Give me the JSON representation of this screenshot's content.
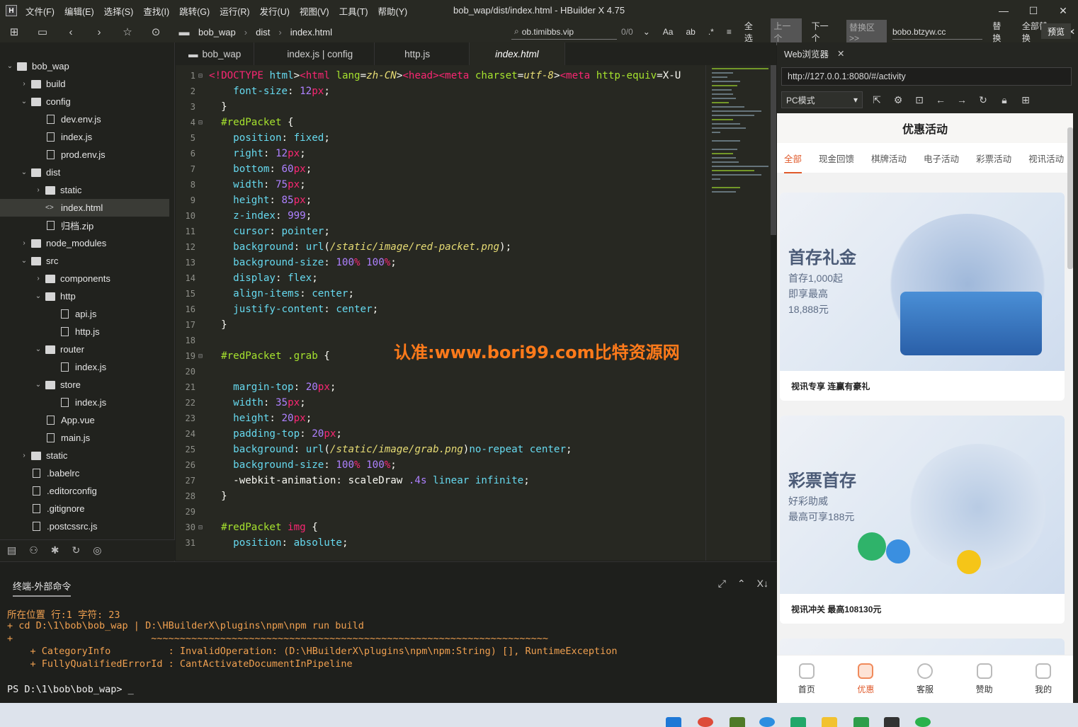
{
  "titlebar": {
    "menus": [
      "文件(F)",
      "编辑(E)",
      "选择(S)",
      "查找(I)",
      "跳转(G)",
      "运行(R)",
      "发行(U)",
      "视图(V)",
      "工具(T)",
      "帮助(Y)"
    ],
    "title": "bob_wap/dist/index.html - HBuilder X 4.75",
    "app_icon": "H"
  },
  "toolbar": {
    "breadcrumb": [
      "bob_wap",
      "dist",
      "index.html"
    ],
    "find": {
      "value": "ob.timibbs.vip",
      "count": "0/0",
      "aa": "Aa",
      "ab": "ab",
      "select_all": "全选",
      "prev": "上一个",
      "next": "下一个",
      "replace_area": "替换区>>",
      "replace_value": "bobo.btzyw.cc",
      "replace": "替换",
      "replace_all": "全部替换"
    },
    "preview": "预览"
  },
  "tree": [
    {
      "label": "bob_wap",
      "indent": 0,
      "arrow": "down",
      "type": "folder"
    },
    {
      "label": "build",
      "indent": 1,
      "arrow": "right",
      "type": "folder"
    },
    {
      "label": "config",
      "indent": 1,
      "arrow": "down",
      "type": "folder"
    },
    {
      "label": "dev.env.js",
      "indent": 2,
      "arrow": "",
      "type": "file"
    },
    {
      "label": "index.js",
      "indent": 2,
      "arrow": "",
      "type": "file"
    },
    {
      "label": "prod.env.js",
      "indent": 2,
      "arrow": "",
      "type": "file"
    },
    {
      "label": "dist",
      "indent": 1,
      "arrow": "down",
      "type": "folder"
    },
    {
      "label": "static",
      "indent": 2,
      "arrow": "right",
      "type": "folder"
    },
    {
      "label": "index.html",
      "indent": 2,
      "arrow": "",
      "type": "code",
      "selected": true
    },
    {
      "label": "归档.zip",
      "indent": 2,
      "arrow": "",
      "type": "file"
    },
    {
      "label": "node_modules",
      "indent": 1,
      "arrow": "right",
      "type": "folder"
    },
    {
      "label": "src",
      "indent": 1,
      "arrow": "down",
      "type": "folder"
    },
    {
      "label": "components",
      "indent": 2,
      "arrow": "right",
      "type": "folder"
    },
    {
      "label": "http",
      "indent": 2,
      "arrow": "down",
      "type": "folder"
    },
    {
      "label": "api.js",
      "indent": 3,
      "arrow": "",
      "type": "file"
    },
    {
      "label": "http.js",
      "indent": 3,
      "arrow": "",
      "type": "file"
    },
    {
      "label": "router",
      "indent": 2,
      "arrow": "down",
      "type": "folder"
    },
    {
      "label": "index.js",
      "indent": 3,
      "arrow": "",
      "type": "file"
    },
    {
      "label": "store",
      "indent": 2,
      "arrow": "down",
      "type": "folder"
    },
    {
      "label": "index.js",
      "indent": 3,
      "arrow": "",
      "type": "file"
    },
    {
      "label": "App.vue",
      "indent": 2,
      "arrow": "",
      "type": "file"
    },
    {
      "label": "main.js",
      "indent": 2,
      "arrow": "",
      "type": "file"
    },
    {
      "label": "static",
      "indent": 1,
      "arrow": "right",
      "type": "folder"
    },
    {
      "label": ".babelrc",
      "indent": 1,
      "arrow": "",
      "type": "file"
    },
    {
      "label": ".editorconfig",
      "indent": 1,
      "arrow": "",
      "type": "file"
    },
    {
      "label": ".gitignore",
      "indent": 1,
      "arrow": "",
      "type": "file"
    },
    {
      "label": ".postcssrc.js",
      "indent": 1,
      "arrow": "",
      "type": "file"
    }
  ],
  "tabs": [
    {
      "label": "bob_wap",
      "active": false
    },
    {
      "label": "index.js | config",
      "active": false
    },
    {
      "label": "http.js",
      "active": false
    },
    {
      "label": "index.html",
      "active": true
    }
  ],
  "code": [
    {
      "n": "1",
      "f": "⊟",
      "t": [
        [
          "kw",
          "<!"
        ],
        [
          "kw",
          "DOCTYPE"
        ],
        [
          "pl",
          " "
        ],
        [
          "prop",
          "html"
        ],
        [
          "pl",
          ">"
        ],
        [
          "kw",
          "<html "
        ],
        [
          "sel2",
          "lang"
        ],
        [
          "pl",
          "="
        ],
        [
          "str",
          "zh-CN"
        ],
        [
          "pl",
          ">"
        ],
        [
          "kw",
          "<head>"
        ],
        [
          "kw",
          "<meta "
        ],
        [
          "sel2",
          "charset"
        ],
        [
          "pl",
          "="
        ],
        [
          "str",
          "utf-8"
        ],
        [
          "pl",
          ">"
        ],
        [
          "kw",
          "<meta "
        ],
        [
          "sel2",
          "http-equiv"
        ],
        [
          "pl",
          "=X-U"
        ]
      ]
    },
    {
      "n": "2",
      "f": "",
      "t": [
        [
          "prop",
          "    font-size"
        ],
        [
          "pl",
          ": "
        ],
        [
          "num",
          "12"
        ],
        [
          "unit",
          "px"
        ],
        [
          "pl",
          ";"
        ]
      ]
    },
    {
      "n": "3",
      "f": "",
      "t": [
        [
          "pl",
          "  }"
        ]
      ]
    },
    {
      "n": "4",
      "f": "⊟",
      "t": [
        [
          "sel2",
          "  #redPacket"
        ],
        [
          "pl",
          " {"
        ]
      ]
    },
    {
      "n": "5",
      "f": "",
      "t": [
        [
          "prop",
          "    position"
        ],
        [
          "pl",
          ": "
        ],
        [
          "val",
          "fixed"
        ],
        [
          "pl",
          ";"
        ]
      ]
    },
    {
      "n": "6",
      "f": "",
      "t": [
        [
          "prop",
          "    right"
        ],
        [
          "pl",
          ": "
        ],
        [
          "num",
          "12"
        ],
        [
          "unit",
          "px"
        ],
        [
          "pl",
          ";"
        ]
      ]
    },
    {
      "n": "7",
      "f": "",
      "t": [
        [
          "prop",
          "    bottom"
        ],
        [
          "pl",
          ": "
        ],
        [
          "num",
          "60"
        ],
        [
          "unit",
          "px"
        ],
        [
          "pl",
          ";"
        ]
      ]
    },
    {
      "n": "8",
      "f": "",
      "t": [
        [
          "prop",
          "    width"
        ],
        [
          "pl",
          ": "
        ],
        [
          "num",
          "75"
        ],
        [
          "unit",
          "px"
        ],
        [
          "pl",
          ";"
        ]
      ]
    },
    {
      "n": "9",
      "f": "",
      "t": [
        [
          "prop",
          "    height"
        ],
        [
          "pl",
          ": "
        ],
        [
          "num",
          "85"
        ],
        [
          "unit",
          "px"
        ],
        [
          "pl",
          ";"
        ]
      ]
    },
    {
      "n": "10",
      "f": "",
      "t": [
        [
          "prop",
          "    z-index"
        ],
        [
          "pl",
          ": "
        ],
        [
          "num",
          "999"
        ],
        [
          "pl",
          ";"
        ]
      ]
    },
    {
      "n": "11",
      "f": "",
      "t": [
        [
          "prop",
          "    cursor"
        ],
        [
          "pl",
          ": "
        ],
        [
          "val",
          "pointer"
        ],
        [
          "pl",
          ";"
        ]
      ]
    },
    {
      "n": "12",
      "f": "",
      "t": [
        [
          "prop",
          "    background"
        ],
        [
          "pl",
          ": "
        ],
        [
          "fn",
          "url"
        ],
        [
          "pl",
          "("
        ],
        [
          "str",
          "/static/image/red-packet.png"
        ],
        [
          "pl",
          ");"
        ]
      ]
    },
    {
      "n": "13",
      "f": "",
      "t": [
        [
          "prop",
          "    background-size"
        ],
        [
          "pl",
          ": "
        ],
        [
          "num",
          "100"
        ],
        [
          "unit",
          "%"
        ],
        [
          "pl",
          " "
        ],
        [
          "num",
          "100"
        ],
        [
          "unit",
          "%"
        ],
        [
          "pl",
          ";"
        ]
      ]
    },
    {
      "n": "14",
      "f": "",
      "t": [
        [
          "prop",
          "    display"
        ],
        [
          "pl",
          ": "
        ],
        [
          "val",
          "flex"
        ],
        [
          "pl",
          ";"
        ]
      ]
    },
    {
      "n": "15",
      "f": "",
      "t": [
        [
          "prop",
          "    align-items"
        ],
        [
          "pl",
          ": "
        ],
        [
          "val",
          "center"
        ],
        [
          "pl",
          ";"
        ]
      ]
    },
    {
      "n": "16",
      "f": "",
      "t": [
        [
          "prop",
          "    justify-content"
        ],
        [
          "pl",
          ": "
        ],
        [
          "val",
          "center"
        ],
        [
          "pl",
          ";"
        ]
      ]
    },
    {
      "n": "17",
      "f": "",
      "t": [
        [
          "pl",
          "  }"
        ]
      ]
    },
    {
      "n": "18",
      "f": "",
      "t": [
        [
          "pl",
          ""
        ]
      ]
    },
    {
      "n": "19",
      "f": "⊟",
      "t": [
        [
          "sel2",
          "  #redPacket .grab"
        ],
        [
          "pl",
          " {"
        ]
      ]
    },
    {
      "n": "20",
      "f": "",
      "t": [
        [
          "pl",
          ""
        ]
      ]
    },
    {
      "n": "21",
      "f": "",
      "t": [
        [
          "prop",
          "    margin-top"
        ],
        [
          "pl",
          ": "
        ],
        [
          "num",
          "20"
        ],
        [
          "unit",
          "px"
        ],
        [
          "pl",
          ";"
        ]
      ]
    },
    {
      "n": "22",
      "f": "",
      "t": [
        [
          "prop",
          "    width"
        ],
        [
          "pl",
          ": "
        ],
        [
          "num",
          "35"
        ],
        [
          "unit",
          "px"
        ],
        [
          "pl",
          ";"
        ]
      ]
    },
    {
      "n": "23",
      "f": "",
      "t": [
        [
          "prop",
          "    height"
        ],
        [
          "pl",
          ": "
        ],
        [
          "num",
          "20"
        ],
        [
          "unit",
          "px"
        ],
        [
          "pl",
          ";"
        ]
      ]
    },
    {
      "n": "24",
      "f": "",
      "t": [
        [
          "prop",
          "    padding-top"
        ],
        [
          "pl",
          ": "
        ],
        [
          "num",
          "20"
        ],
        [
          "unit",
          "px"
        ],
        [
          "pl",
          ";"
        ]
      ]
    },
    {
      "n": "25",
      "f": "",
      "t": [
        [
          "prop",
          "    background"
        ],
        [
          "pl",
          ": "
        ],
        [
          "fn",
          "url"
        ],
        [
          "pl",
          "("
        ],
        [
          "str",
          "/static/image/grab.png"
        ],
        [
          "pl",
          ")"
        ],
        [
          "val",
          "no-repeat"
        ],
        [
          "pl",
          " "
        ],
        [
          "val",
          "center"
        ],
        [
          "pl",
          ";"
        ]
      ]
    },
    {
      "n": "26",
      "f": "",
      "t": [
        [
          "prop",
          "    background-size"
        ],
        [
          "pl",
          ": "
        ],
        [
          "num",
          "100"
        ],
        [
          "unit",
          "%"
        ],
        [
          "pl",
          " "
        ],
        [
          "num",
          "100"
        ],
        [
          "unit",
          "%"
        ],
        [
          "pl",
          ";"
        ]
      ]
    },
    {
      "n": "27",
      "f": "",
      "t": [
        [
          "pl",
          "    -webkit-animation: scaleDraw "
        ],
        [
          "num",
          ".4s"
        ],
        [
          "pl",
          " "
        ],
        [
          "val",
          "linear"
        ],
        [
          "pl",
          " "
        ],
        [
          "val",
          "infinite"
        ],
        [
          "pl",
          ";"
        ]
      ]
    },
    {
      "n": "28",
      "f": "",
      "t": [
        [
          "pl",
          "  }"
        ]
      ]
    },
    {
      "n": "29",
      "f": "",
      "t": [
        [
          "pl",
          ""
        ]
      ]
    },
    {
      "n": "30",
      "f": "⊟",
      "t": [
        [
          "sel2",
          "  #redPacket "
        ],
        [
          "kw",
          "img"
        ],
        [
          "pl",
          " {"
        ]
      ]
    },
    {
      "n": "31",
      "f": "",
      "t": [
        [
          "prop",
          "    position"
        ],
        [
          "pl",
          ": "
        ],
        [
          "val",
          "absolute"
        ],
        [
          "pl",
          ";"
        ]
      ]
    }
  ],
  "watermark": "认准:www.bori99.com比特资源网",
  "browser": {
    "tab": "Web浏览器",
    "url": "http://127.0.0.1:8080/#/activity",
    "mode": "PC模式",
    "page_title": "优惠活动",
    "cats": [
      "全部",
      "现金回馈",
      "棋牌活动",
      "电子活动",
      "彩票活动",
      "视讯活动"
    ],
    "cards": [
      {
        "head": "首存礼金",
        "lines": [
          "首存1,000起",
          "即享最高",
          "18,888元"
        ],
        "caption": "视讯专享 连赢有豪礼"
      },
      {
        "head": "彩票首存",
        "lines": [
          "好彩助威",
          "最高可享188元"
        ],
        "caption": "视讯冲关 最高108130元"
      }
    ],
    "nav": [
      "首页",
      "优惠",
      "客服",
      "赞助",
      "我的"
    ]
  },
  "terminal": {
    "tab": "终端-外部命令",
    "lines": [
      "所在位置 行:1 字符: 23",
      "+ cd D:\\1\\bob\\bob_wap | D:\\HBuilderX\\plugins\\npm\\npm run build",
      "+                        ~~~~~~~~~~~~~~~~~~~~~~~~~~~~~~~~~~~~~~~~~~~~~~~~~~~~~~~~~~~~~~~~~~~~~",
      "    + CategoryInfo          : InvalidOperation: (D:\\HBuilderX\\plugins\\npm\\npm:String) [], RuntimeException",
      "    + FullyQualifiedErrorId : CantActivateDocumentInPipeline"
    ],
    "prompt": "PS D:\\1\\bob\\bob_wap> _"
  }
}
